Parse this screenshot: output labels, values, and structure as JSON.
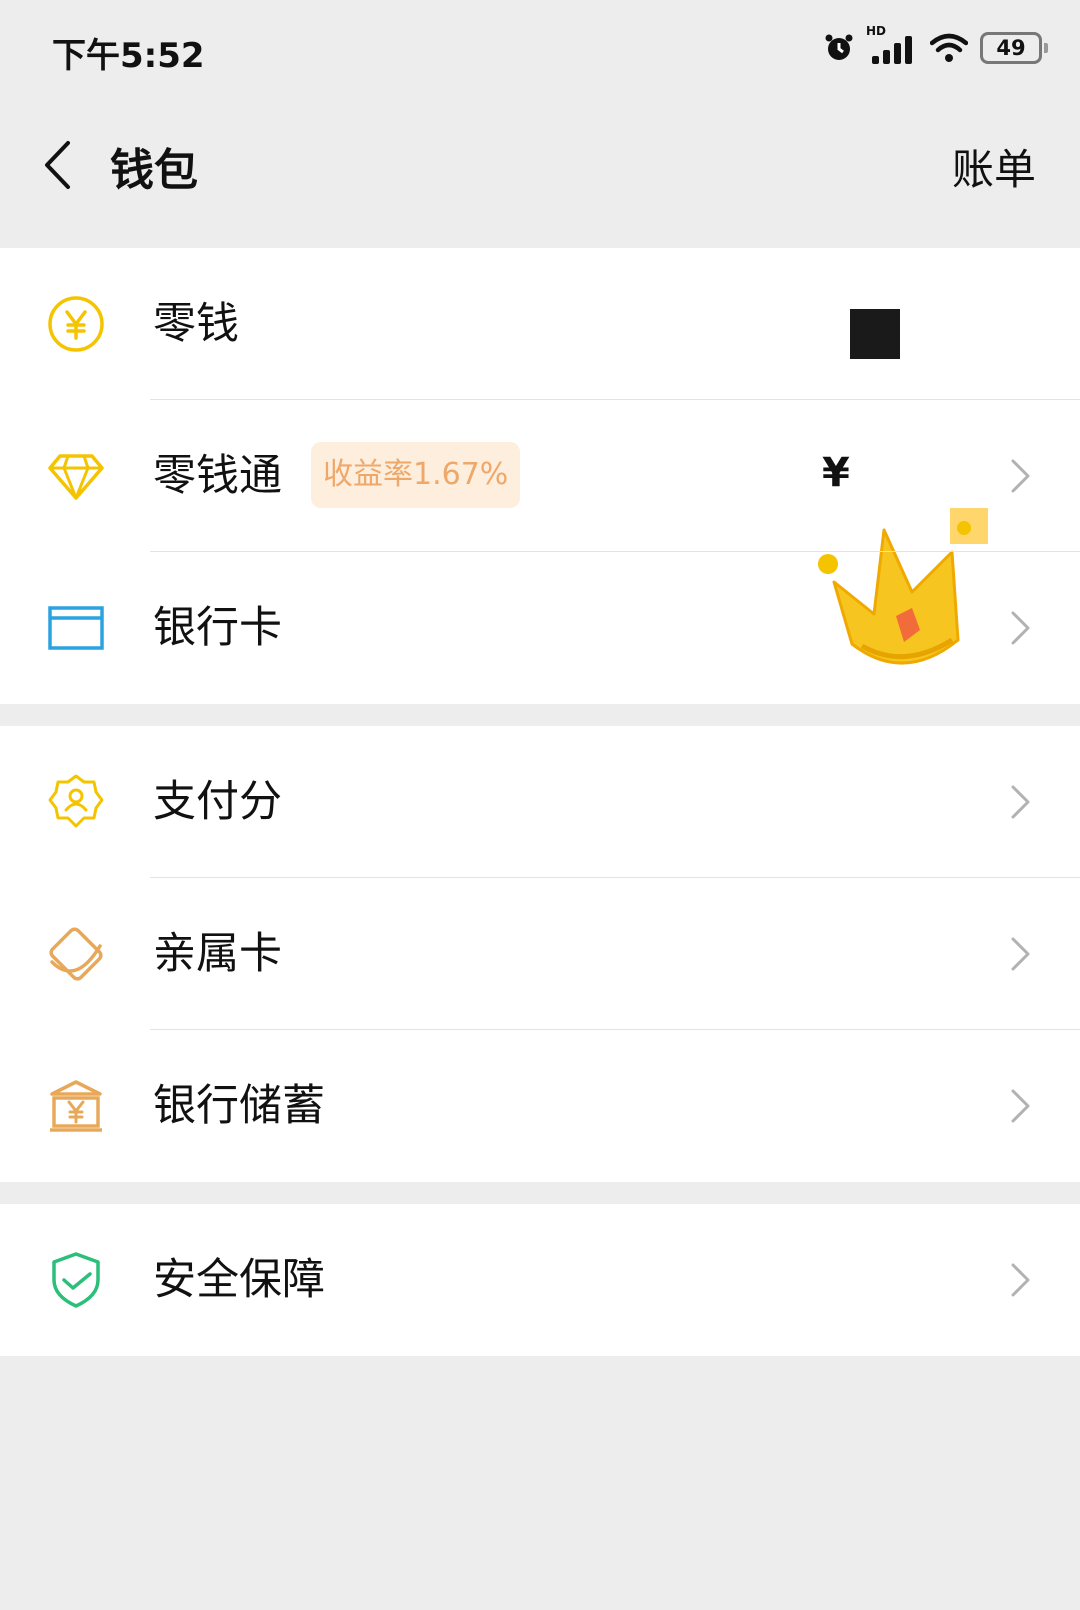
{
  "status_bar": {
    "time": "下午5:52",
    "battery": "49",
    "network_label": "HD"
  },
  "nav": {
    "title": "钱包",
    "right_action": "账单"
  },
  "groups": [
    {
      "items": [
        {
          "label": "零钱",
          "icon": "yuan-circle-icon"
        },
        {
          "label": "零钱通",
          "icon": "diamond-icon",
          "badge": "收益率1.67%",
          "amount": "¥"
        },
        {
          "label": "银行卡",
          "icon": "bank-card-icon"
        }
      ]
    },
    {
      "items": [
        {
          "label": "支付分",
          "icon": "pay-score-icon"
        },
        {
          "label": "亲属卡",
          "icon": "family-card-icon"
        },
        {
          "label": "银行储蓄",
          "icon": "bank-savings-icon"
        }
      ]
    },
    {
      "items": [
        {
          "label": "安全保障",
          "icon": "security-shield-icon"
        }
      ]
    }
  ],
  "colors": {
    "background": "#ededed",
    "yellow_icon": "#f5c400",
    "orange_icon": "#e8a85a",
    "blue_icon": "#2aa3e0",
    "green_icon": "#2bbf7a",
    "badge_bg": "#fdeedd",
    "badge_text": "#eea86a"
  }
}
